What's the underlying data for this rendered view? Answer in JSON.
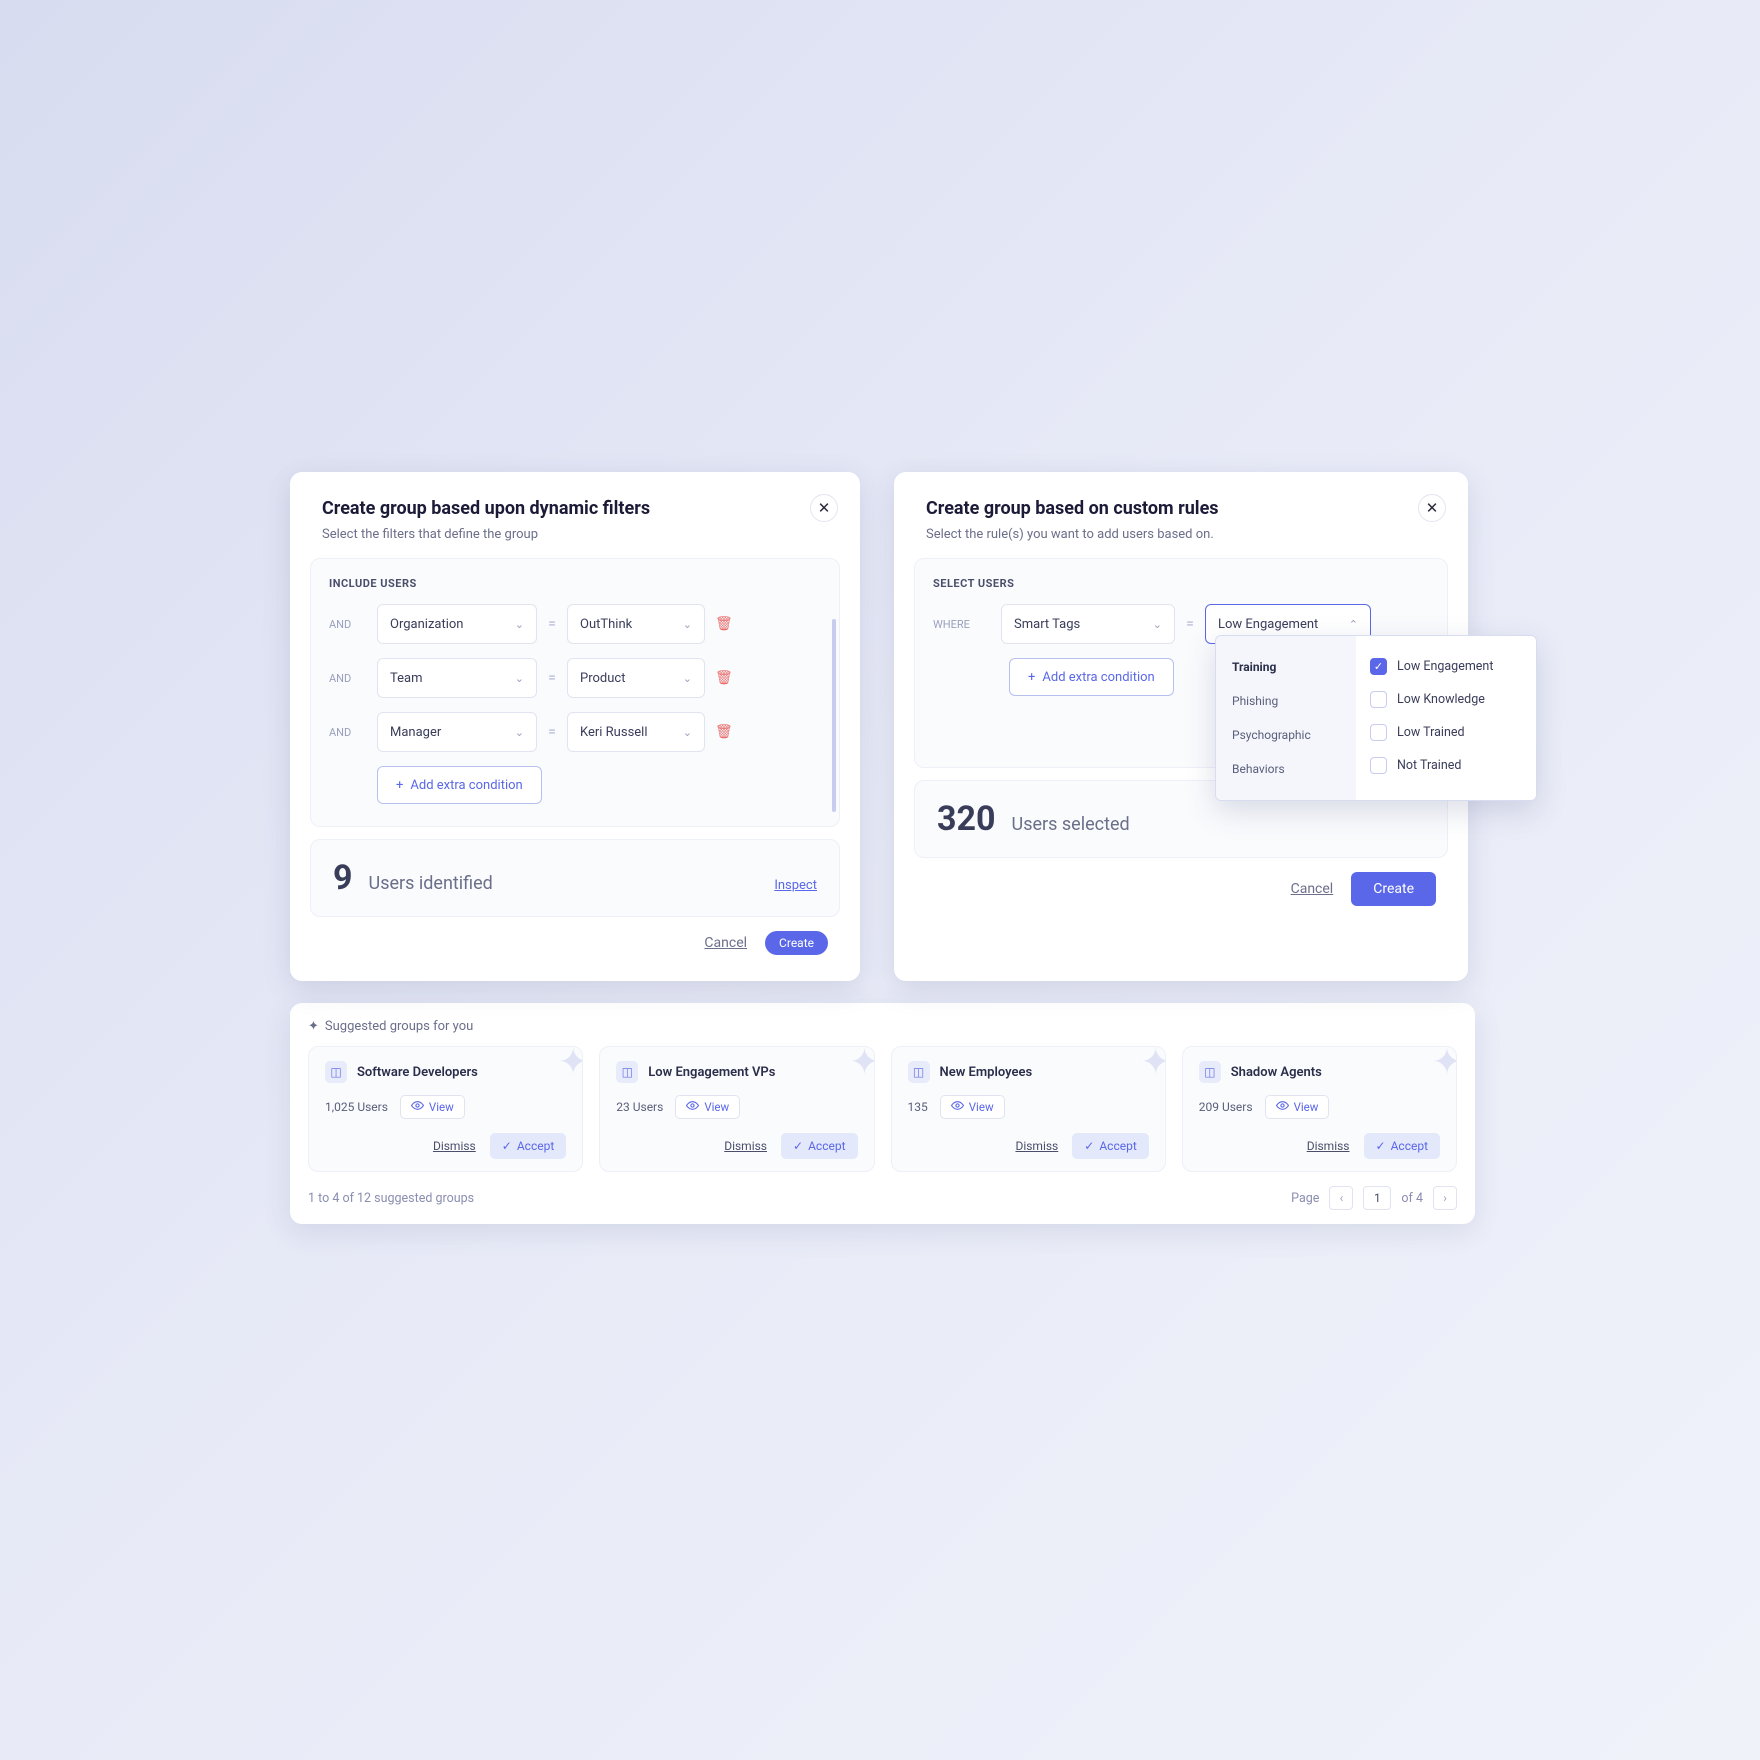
{
  "left": {
    "title": "Create group based upon dynamic filters",
    "subtitle": "Select the filters that define the group",
    "section": "INCLUDE USERS",
    "and": "AND",
    "eq": "=",
    "rows": [
      {
        "field": "Organization",
        "value": "OutThink"
      },
      {
        "field": "Team",
        "value": "Product"
      },
      {
        "field": "Manager",
        "value": "Keri Russell"
      }
    ],
    "add": "Add extra condition",
    "count": "9",
    "count_label": "Users identified",
    "inspect": "Inspect",
    "cancel": "Cancel",
    "create": "Create"
  },
  "right": {
    "title": "Create group based on custom rules",
    "subtitle": "Select the rule(s) you want to add users based on.",
    "section": "SELECT USERS",
    "where": "WHERE",
    "eq": "=",
    "field": "Smart Tags",
    "value": "Low Engagement",
    "add": "Add extra condition",
    "count": "320",
    "count_label": "Users selected",
    "cancel": "Cancel",
    "create": "Create",
    "dropdown": {
      "tabs": [
        "Training",
        "Phishing",
        "Psychographic",
        "Behaviors"
      ],
      "active_tab": "Training",
      "options": [
        {
          "label": "Low Engagement",
          "checked": true
        },
        {
          "label": "Low Knowledge",
          "checked": false
        },
        {
          "label": "Low Trained",
          "checked": false
        },
        {
          "label": "Not Trained",
          "checked": false
        }
      ]
    }
  },
  "suggested": {
    "heading": "Suggested groups for you",
    "cards": [
      {
        "name": "Software Developers",
        "count": "1,025 Users"
      },
      {
        "name": "Low Engagement VPs",
        "count": "23 Users"
      },
      {
        "name": "New Employees",
        "count": "135"
      },
      {
        "name": "Shadow Agents",
        "count": "209 Users"
      }
    ],
    "view": "View",
    "dismiss": "Dismiss",
    "accept": "Accept",
    "pager_left": "1 to 4 of 12 suggested groups",
    "page_label": "Page",
    "page_num": "1",
    "of_pages": "of 4"
  }
}
